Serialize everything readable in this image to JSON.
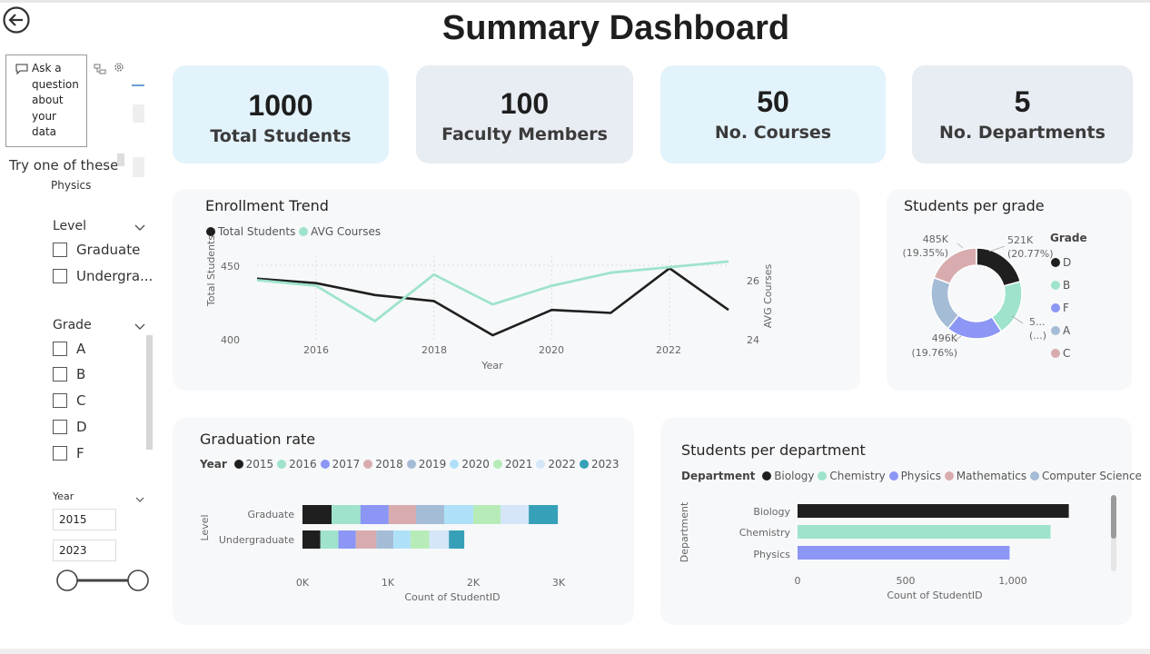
{
  "title": "Summary Dashboard",
  "kpis": [
    {
      "value": "1000",
      "label": "Total Students"
    },
    {
      "value": "100",
      "label": "Faculty Members"
    },
    {
      "value": "50",
      "label": "No. Courses"
    },
    {
      "value": "5",
      "label": "No. Departments"
    }
  ],
  "qa": {
    "ask": "Ask a question about your data",
    "try": "Try one of these",
    "suggestion": "Physics"
  },
  "filters": {
    "level": {
      "title": "Level",
      "options": [
        "Graduate",
        "Undergra..."
      ]
    },
    "grade": {
      "title": "Grade",
      "options": [
        "A",
        "B",
        "C",
        "D",
        "F"
      ]
    },
    "year": {
      "title": "Year",
      "from": "2015",
      "to": "2023"
    }
  },
  "enrollment": {
    "title": "Enrollment Trend",
    "legend": [
      "Total Students",
      "AVG Courses"
    ],
    "xlabel": "Year",
    "ylabel_left": "Total Students",
    "ylabel_right": "AVG Courses",
    "xticks": [
      "2016",
      "2018",
      "2020",
      "2022"
    ],
    "yticks_left": [
      "450",
      "400"
    ],
    "yticks_right": [
      "26",
      "24"
    ]
  },
  "grade_chart": {
    "title": "Students per grade",
    "legend_title": "Grade",
    "legend": [
      "D",
      "B",
      "F",
      "A",
      "C"
    ],
    "labels": {
      "d": "521K",
      "d_pct": "(20.77%)",
      "b": "5...",
      "b_pct": "(...)",
      "a": "496K",
      "a_pct": "(19.76%)",
      "c": "485K",
      "c_pct": "(19.35%)"
    }
  },
  "graduation": {
    "title": "Graduation rate",
    "legend_title": "Year",
    "ylabel": "Level",
    "xlabel": "Count of StudentID",
    "xticks": [
      "0K",
      "1K",
      "2K",
      "3K"
    ]
  },
  "department": {
    "title": "Students per department",
    "legend_title": "Department",
    "legend": [
      "Biology",
      "Chemistry",
      "Physics",
      "Mathematics",
      "Computer Science"
    ],
    "ylabel": "Department",
    "xlabel": "Count of StudentID",
    "xticks": [
      "0",
      "500",
      "1,000"
    ]
  },
  "chart_data": [
    {
      "type": "line",
      "title": "Enrollment Trend",
      "xlabel": "Year",
      "x": [
        2015,
        2016,
        2017,
        2018,
        2019,
        2020,
        2021,
        2022,
        2023
      ],
      "series": [
        {
          "name": "Total Students",
          "axis": "left",
          "values": [
            441,
            438,
            430,
            426,
            403,
            420,
            418,
            448,
            420
          ]
        },
        {
          "name": "AVG Courses",
          "axis": "right",
          "values": [
            25.6,
            25.45,
            24.5,
            25.75,
            24.95,
            25.45,
            25.8,
            25.95,
            26.1
          ]
        }
      ],
      "ylim_left": [
        400,
        450
      ],
      "ylim_right": [
        24,
        26
      ],
      "colors": {
        "Total Students": "#1f1f1f",
        "AVG Courses": "#9fe3cc"
      }
    },
    {
      "type": "pie",
      "title": "Students per grade",
      "categories": [
        "D",
        "B",
        "F",
        "A",
        "C"
      ],
      "values": [
        20.77,
        20.0,
        20.12,
        19.76,
        19.35
      ],
      "colors": [
        "#1f1f1f",
        "#9fe3cc",
        "#8b96f5",
        "#a5bcd6",
        "#d8acae"
      ]
    },
    {
      "type": "bar",
      "title": "Graduation rate",
      "orientation": "horizontal",
      "stacked": true,
      "categories": [
        "Graduate",
        "Undergraduate"
      ],
      "series": [
        {
          "name": "2015",
          "color": "#1f1f1f",
          "values": [
            340,
            210
          ]
        },
        {
          "name": "2016",
          "color": "#9fe3cc",
          "values": [
            340,
            210
          ]
        },
        {
          "name": "2017",
          "color": "#8b96f5",
          "values": [
            330,
            205
          ]
        },
        {
          "name": "2018",
          "color": "#d8acae",
          "values": [
            320,
            240
          ]
        },
        {
          "name": "2019",
          "color": "#a5bcd6",
          "values": [
            330,
            200
          ]
        },
        {
          "name": "2020",
          "color": "#aee1f8",
          "values": [
            340,
            200
          ]
        },
        {
          "name": "2021",
          "color": "#b7ecb9",
          "values": [
            320,
            220
          ]
        },
        {
          "name": "2022",
          "color": "#d4e6f7",
          "values": [
            330,
            230
          ]
        },
        {
          "name": "2023",
          "color": "#36a0b8",
          "values": [
            340,
            180
          ]
        }
      ],
      "xlim": [
        0,
        3000
      ]
    },
    {
      "type": "bar",
      "title": "Students per department",
      "orientation": "horizontal",
      "categories": [
        "Biology",
        "Chemistry",
        "Physics"
      ],
      "values": [
        1260,
        1175,
        985
      ],
      "colors": [
        "#1f1f1f",
        "#9fe3cc",
        "#8b96f5"
      ],
      "xlim": [
        0,
        1300
      ]
    }
  ]
}
